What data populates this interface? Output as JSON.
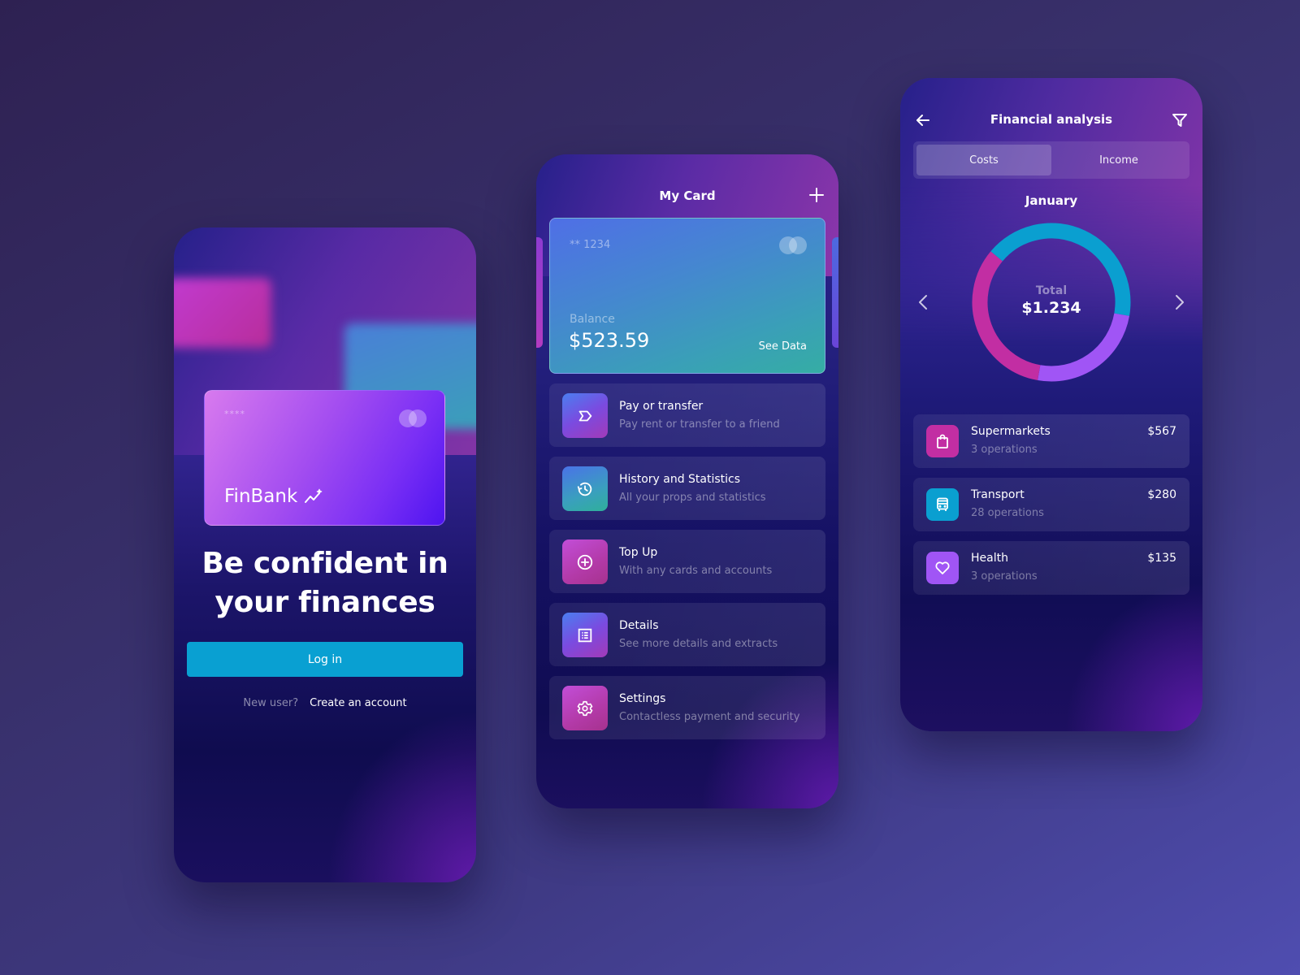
{
  "login_screen": {
    "card": {
      "masked_number": "****",
      "brand": "FinBank",
      "brand_icon": "sparkle-chart-icon",
      "network_icon": "mastercard-logo-icon"
    },
    "headline_line1": "Be confident in",
    "headline_line2": "your finances",
    "login_button": "Log in",
    "new_user_label": "New user?",
    "create_account_link": "Create an account"
  },
  "card_screen": {
    "title": "My Card",
    "add_icon": "plus-icon",
    "card": {
      "masked_number": "** 1234",
      "network_icon": "mastercard-logo-icon",
      "balance_label": "Balance",
      "balance_value": "$523.59",
      "see_data_link": "See Data"
    },
    "menu": [
      {
        "title": "Pay or transfer",
        "subtitle": "Pay rent or transfer to a friend",
        "icon": "transfer-arrow-icon"
      },
      {
        "title": "History and Statistics",
        "subtitle": "All your props and statistics",
        "icon": "history-icon"
      },
      {
        "title": "Top Up",
        "subtitle": "With any cards and accounts",
        "icon": "plus-circle-icon"
      },
      {
        "title": "Details",
        "subtitle": "See more details and extracts",
        "icon": "list-icon"
      },
      {
        "title": "Settings",
        "subtitle": "Contactless payment and security",
        "icon": "gear-icon"
      }
    ]
  },
  "analysis_screen": {
    "title": "Financial analysis",
    "back_icon": "arrow-left-icon",
    "filter_icon": "filter-icon",
    "tabs": [
      {
        "label": "Costs",
        "active": true
      },
      {
        "label": "Income",
        "active": false
      }
    ],
    "month": "January",
    "total_label": "Total",
    "total_value": "$1.234",
    "categories": [
      {
        "name": "Supermarkets",
        "operations": "3 operations",
        "amount": "$567",
        "icon": "shopping-bag-icon",
        "color": "#c22ea3"
      },
      {
        "name": "Transport",
        "operations": "28 operations",
        "amount": "$280",
        "icon": "bus-icon",
        "color": "#0a9fd0"
      },
      {
        "name": "Health",
        "operations": "3 operations",
        "amount": "$135",
        "icon": "heart-icon",
        "color": "#a055f5"
      }
    ]
  },
  "chart_data": {
    "type": "pie",
    "title": "January",
    "center_label": "Total",
    "center_value": "$1.234",
    "series": [
      {
        "name": "Transport",
        "color": "#0a9fd0",
        "start_deg": -50,
        "end_deg": 100
      },
      {
        "name": "Health",
        "color": "#a055f5",
        "start_deg": 100,
        "end_deg": 190
      },
      {
        "name": "Supermarkets",
        "color": "#c22ea3",
        "start_deg": 190,
        "end_deg": 310
      }
    ]
  },
  "colors": {
    "accent_button": "#09a0d2",
    "transport": "#0a9fd0",
    "health": "#a055f5",
    "supermarkets": "#c22ea3"
  }
}
